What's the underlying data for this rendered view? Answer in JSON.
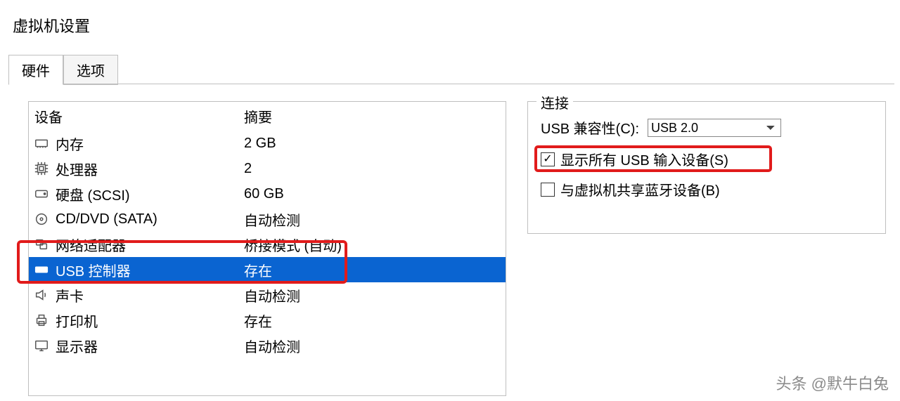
{
  "window": {
    "title": "虚拟机设置"
  },
  "tabs": [
    {
      "label": "硬件",
      "active": true
    },
    {
      "label": "选项",
      "active": false
    }
  ],
  "device_list": {
    "headers": {
      "device": "设备",
      "summary": "摘要"
    },
    "rows": [
      {
        "icon": "memory-icon",
        "name": "内存",
        "summary": "2 GB",
        "selected": false
      },
      {
        "icon": "cpu-icon",
        "name": "处理器",
        "summary": "2",
        "selected": false
      },
      {
        "icon": "disk-icon",
        "name": "硬盘 (SCSI)",
        "summary": "60 GB",
        "selected": false
      },
      {
        "icon": "cd-icon",
        "name": "CD/DVD (SATA)",
        "summary": "自动检测",
        "selected": false
      },
      {
        "icon": "network-icon",
        "name": "网络适配器",
        "summary": "桥接模式 (自动)",
        "selected": false
      },
      {
        "icon": "usb-icon",
        "name": "USB 控制器",
        "summary": "存在",
        "selected": true
      },
      {
        "icon": "sound-icon",
        "name": "声卡",
        "summary": "自动检测",
        "selected": false
      },
      {
        "icon": "printer-icon",
        "name": "打印机",
        "summary": "存在",
        "selected": false
      },
      {
        "icon": "display-icon",
        "name": "显示器",
        "summary": "自动检测",
        "selected": false
      }
    ]
  },
  "connections": {
    "group_label": "连接",
    "compat_label": "USB 兼容性(C):",
    "compat_value": "USB 2.0",
    "show_all_usb": {
      "label": "显示所有 USB 输入设备(S)",
      "checked": true
    },
    "share_bt": {
      "label": "与虚拟机共享蓝牙设备(B)",
      "checked": false
    }
  },
  "watermark": "头条 @默牛白兔"
}
